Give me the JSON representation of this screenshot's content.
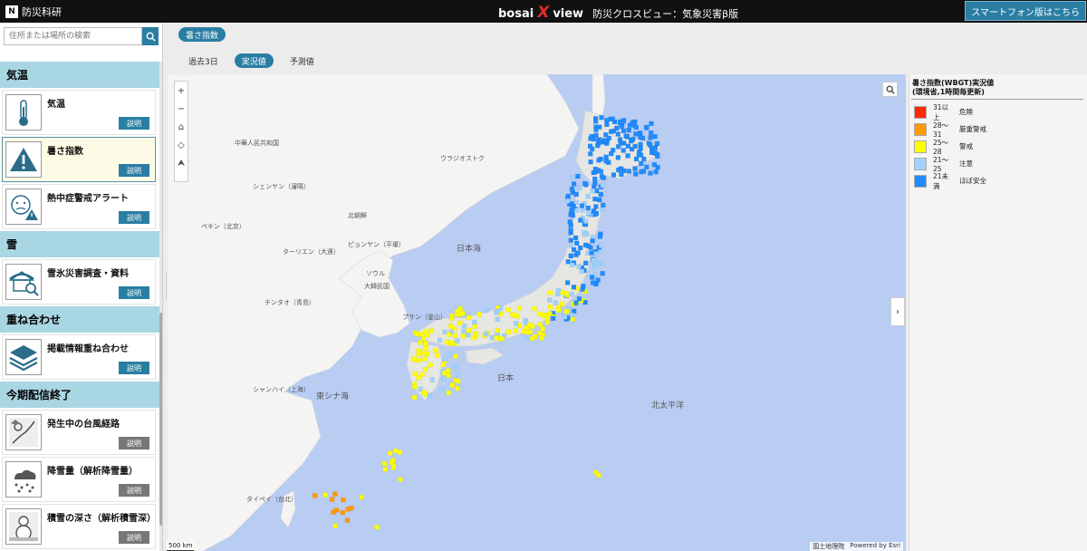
{
  "header": {
    "logo_text": "防災科研",
    "logo_mark": "N",
    "brand_a": "bosai",
    "brand_x": "X",
    "brand_b": "view",
    "subtitle": "防災クロスビュー：気象災害β版",
    "smartphone_label": "スマートフォン版はこちら"
  },
  "search": {
    "placeholder": "住所または場所の検索"
  },
  "sidebar": {
    "categories": {
      "temp": "気温",
      "snow": "雪",
      "overlay": "重ね合わせ",
      "ended": "今期配信終了"
    },
    "items": [
      {
        "title": "気温",
        "button": "説明",
        "icon": "thermometer-icon"
      },
      {
        "title": "暑さ指数",
        "button": "説明",
        "icon": "warning-triangle-icon",
        "selected": true
      },
      {
        "title": "熱中症警戒アラート",
        "button": "説明",
        "icon": "heatstroke-alert-icon"
      },
      {
        "title": "雪氷災害調査・資料",
        "button": "説明",
        "icon": "snow-house-icon"
      },
      {
        "title": "掲載情報重ね合わせ",
        "button": "説明",
        "icon": "layers-icon"
      },
      {
        "title": "発生中の台風経路",
        "button": "説明",
        "icon": "typhoon-track-icon"
      },
      {
        "title": "降雪量（解析降雪量）",
        "button": "説明",
        "icon": "snowfall-icon"
      },
      {
        "title": "積雪の深さ（解析積雪深）",
        "button": "説明",
        "icon": "snowman-icon"
      }
    ]
  },
  "layer_chip": "暑さ指数",
  "tabs": [
    {
      "label": "過去3日",
      "active": false
    },
    {
      "label": "実況値",
      "active": true
    },
    {
      "label": "予測値",
      "active": false
    }
  ],
  "legend": {
    "title_line1": "暑さ指数(WBGT)実況値",
    "title_line2": "(環境省,1時間毎更新)",
    "items": [
      {
        "range": "31以上",
        "label": "危険",
        "color": "#ff2800"
      },
      {
        "range": "28～31",
        "label": "厳重警戒",
        "color": "#ff9900"
      },
      {
        "range": "25～28",
        "label": "警戒",
        "color": "#ffff00"
      },
      {
        "range": "21～25",
        "label": "注意",
        "color": "#a0d2ff"
      },
      {
        "range": "21未満",
        "label": "ほぼ安全",
        "color": "#218cff"
      }
    ]
  },
  "map": {
    "labels": {
      "china": "中華人民共和国",
      "vladivostok": "ウラジオストク",
      "shenyang": "シェンヤン（瀋陽）",
      "beijing": "ペキン（北京）",
      "north_korea": "北朝鮮",
      "dalian": "ターリエン（大連）",
      "pyongyang": "ピョンヤン（平壌）",
      "seoul": "ソウル",
      "rok": "大韓民国",
      "qingdao": "チンタオ（青島）",
      "sea_of_japan": "日本海",
      "busan": "プサン（釜山）",
      "shanghai": "シャンハイ（上海）",
      "east_china_sea": "東シナ海",
      "japan": "日本",
      "pacific": "北太平洋",
      "taipei": "タイペイ（台北）"
    },
    "scale": "500 km",
    "attribution_1": "国土地理院",
    "attribution_2": "Powered by Esri"
  }
}
